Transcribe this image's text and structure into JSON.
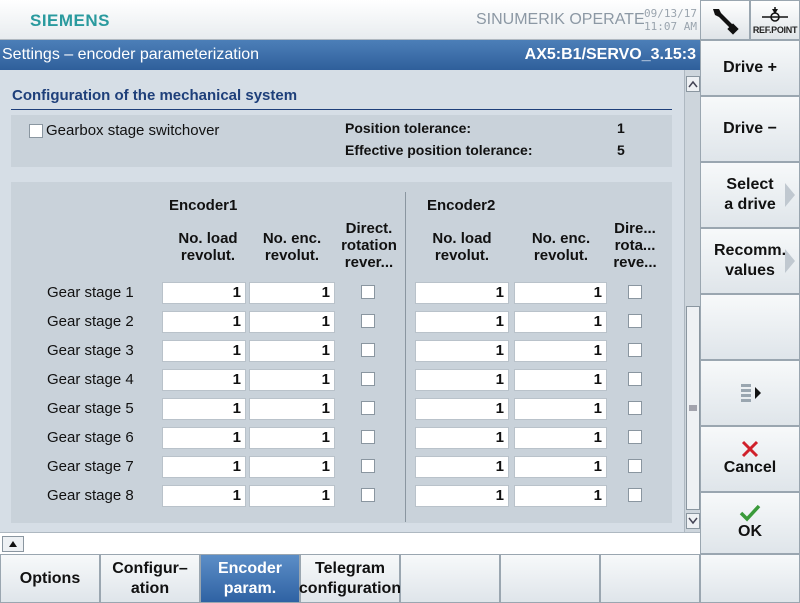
{
  "header": {
    "brand": "SIEMENS",
    "product": "SINUMERIK OPERATE",
    "date": "09/13/17",
    "time": "11:07 AM",
    "refpoint_label": "REF.POINT"
  },
  "titlebar": {
    "title": "Settings – encoder parameterization",
    "axis": "AX5:B1/SERVO_3.15:3"
  },
  "section": {
    "title": "Configuration of the mechanical system",
    "gearbox_label": "Gearbox stage switchover",
    "gearbox_checked": false,
    "position_tolerance_label": "Position tolerance:",
    "position_tolerance_value": "1",
    "effective_tolerance_label": "Effective position tolerance:",
    "effective_tolerance_value": "5"
  },
  "table": {
    "encoder1": "Encoder1",
    "encoder2": "Encoder2",
    "col_load": [
      "No. load",
      "revolut."
    ],
    "col_enc": [
      "No. enc.",
      "revolut."
    ],
    "col_dir1": [
      "Direct.",
      "rotation",
      "rever..."
    ],
    "col_dir2": [
      "Dire...",
      "rota...",
      "reve..."
    ],
    "rows": [
      {
        "label": "Gear stage 1",
        "e1_load": "1",
        "e1_enc": "1",
        "e2_load": "1",
        "e2_enc": "1"
      },
      {
        "label": "Gear stage 2",
        "e1_load": "1",
        "e1_enc": "1",
        "e2_load": "1",
        "e2_enc": "1"
      },
      {
        "label": "Gear stage 3",
        "e1_load": "1",
        "e1_enc": "1",
        "e2_load": "1",
        "e2_enc": "1"
      },
      {
        "label": "Gear stage 4",
        "e1_load": "1",
        "e1_enc": "1",
        "e2_load": "1",
        "e2_enc": "1"
      },
      {
        "label": "Gear stage 5",
        "e1_load": "1",
        "e1_enc": "1",
        "e2_load": "1",
        "e2_enc": "1"
      },
      {
        "label": "Gear stage 6",
        "e1_load": "1",
        "e1_enc": "1",
        "e2_load": "1",
        "e2_enc": "1"
      },
      {
        "label": "Gear stage 7",
        "e1_load": "1",
        "e1_enc": "1",
        "e2_load": "1",
        "e2_enc": "1"
      },
      {
        "label": "Gear stage 8",
        "e1_load": "1",
        "e1_enc": "1",
        "e2_load": "1",
        "e2_enc": "1"
      }
    ]
  },
  "vertical_softkeys": {
    "drive_plus": "Drive +",
    "drive_minus": "Drive −",
    "select_drive": [
      "Select",
      "a drive"
    ],
    "recomm_values": [
      "Recomm.",
      "values"
    ],
    "cancel": "Cancel",
    "ok": "OK"
  },
  "horizontal_softkeys": {
    "options": "Options",
    "configuration": [
      "Configur–",
      "ation"
    ],
    "encoder_param": [
      "Encoder",
      "param."
    ],
    "telegram": [
      "Telegram",
      "configuration"
    ]
  },
  "colors": {
    "accent": "#2f5f9b",
    "brand": "#2a9a9e",
    "cancel_icon": "#d0202a",
    "ok_icon": "#3a9a3a"
  }
}
